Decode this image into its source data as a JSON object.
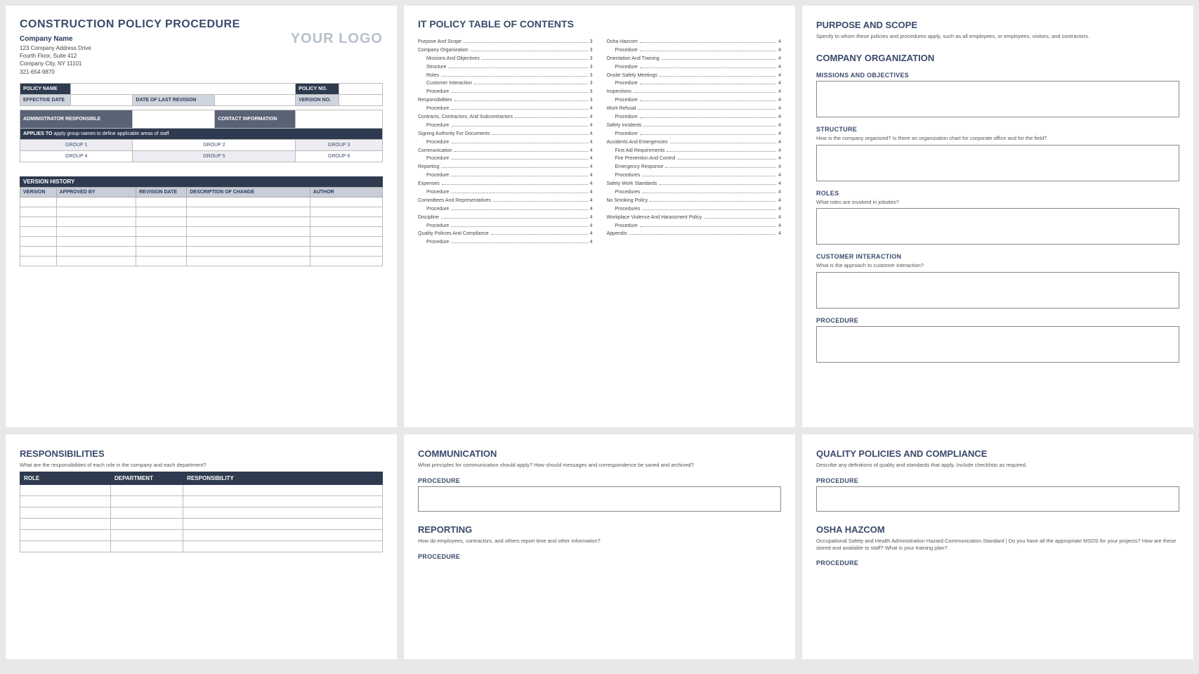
{
  "page1": {
    "title": "CONSTRUCTION POLICY PROCEDURE",
    "company": "Company Name",
    "addr1": "123 Company Address Drive",
    "addr2": "Fourth Floor, Suite 412",
    "addr3": "Company City, NY  11101",
    "phone": "321-654-9870",
    "logo": "YOUR LOGO",
    "labels": {
      "policy_name": "POLICY NAME",
      "policy_no": "POLICY NO.",
      "effective_date": "EFFECTIVE DATE",
      "last_revision": "DATE OF LAST REVISION",
      "version_no": "VERSION NO.",
      "admin": "ADMINISTRATOR RESPONSIBLE",
      "contact": "CONTACT INFORMATION",
      "applies_to_label": "APPLIES TO",
      "applies_to_text": "apply group names to define applicable areas of staff"
    },
    "groups": [
      "GROUP 1",
      "GROUP 2",
      "GROUP 3",
      "GROUP 4",
      "GROUP 5",
      "GROUP 6"
    ],
    "version_history": "VERSION HISTORY",
    "ver_headers": [
      "VERSION",
      "APPROVED BY",
      "REVISION DATE",
      "DESCRIPTION OF CHANGE",
      "AUTHOR"
    ]
  },
  "page2": {
    "title": "IT POLICY TABLE OF CONTENTS",
    "col1": [
      {
        "t": "Purpose And Scope",
        "p": "3",
        "i": 0
      },
      {
        "t": "Company Organization",
        "p": "3",
        "i": 0
      },
      {
        "t": "Missions And Objectives",
        "p": "3",
        "i": 1
      },
      {
        "t": "Structure",
        "p": "3",
        "i": 1
      },
      {
        "t": "Roles",
        "p": "3",
        "i": 1
      },
      {
        "t": "Customer Interaction",
        "p": "3",
        "i": 1
      },
      {
        "t": "Procedure",
        "p": "3",
        "i": 1
      },
      {
        "t": "Responsibilities",
        "p": "3",
        "i": 0
      },
      {
        "t": "Procedure",
        "p": "4",
        "i": 1
      },
      {
        "t": "Contracts, Contractors, And Subcontractors",
        "p": "4",
        "i": 0
      },
      {
        "t": "Procedure",
        "p": "4",
        "i": 1
      },
      {
        "t": "Signing Authority For Documents",
        "p": "4",
        "i": 0
      },
      {
        "t": "Procedure",
        "p": "4",
        "i": 1
      },
      {
        "t": "Communication",
        "p": "4",
        "i": 0
      },
      {
        "t": "Procedure",
        "p": "4",
        "i": 1
      },
      {
        "t": "Reporting",
        "p": "4",
        "i": 0
      },
      {
        "t": "Procedure",
        "p": "4",
        "i": 1
      },
      {
        "t": "Expenses",
        "p": "4",
        "i": 0
      },
      {
        "t": "Procedure",
        "p": "4",
        "i": 1
      },
      {
        "t": "Committees And Representatives",
        "p": "4",
        "i": 0
      },
      {
        "t": "Procedure",
        "p": "4",
        "i": 1
      },
      {
        "t": "Discipline",
        "p": "4",
        "i": 0
      },
      {
        "t": "Procedure",
        "p": "4",
        "i": 1
      },
      {
        "t": "Quality Policies And Compliance",
        "p": "4",
        "i": 0
      },
      {
        "t": "Procedure",
        "p": "4",
        "i": 1
      }
    ],
    "col2": [
      {
        "t": "Osha Hazcom",
        "p": "4",
        "i": 0
      },
      {
        "t": "Procedure",
        "p": "4",
        "i": 1
      },
      {
        "t": "Orientation And Training",
        "p": "4",
        "i": 0
      },
      {
        "t": "Procedure",
        "p": "4",
        "i": 1
      },
      {
        "t": "Onsite Safety Meetings",
        "p": "4",
        "i": 0
      },
      {
        "t": "Procedure",
        "p": "4",
        "i": 1
      },
      {
        "t": "Inspections",
        "p": "4",
        "i": 0
      },
      {
        "t": "Procedure",
        "p": "4",
        "i": 1
      },
      {
        "t": "Work Refusal",
        "p": "4",
        "i": 0
      },
      {
        "t": "Procedure",
        "p": "4",
        "i": 1
      },
      {
        "t": "Safety Incidents",
        "p": "4",
        "i": 0
      },
      {
        "t": "Procedure",
        "p": "4",
        "i": 1
      },
      {
        "t": "Accidents And Emergencies",
        "p": "4",
        "i": 0
      },
      {
        "t": "First Aid Requirements",
        "p": "4",
        "i": 1
      },
      {
        "t": "Fire Prevention And Control",
        "p": "4",
        "i": 1
      },
      {
        "t": "Emergency Response",
        "p": "4",
        "i": 1
      },
      {
        "t": "Procedures",
        "p": "4",
        "i": 1
      },
      {
        "t": "Safety Work Standards",
        "p": "4",
        "i": 0
      },
      {
        "t": "Procedures",
        "p": "4",
        "i": 1
      },
      {
        "t": "No Smoking Policy",
        "p": "4",
        "i": 0
      },
      {
        "t": "Procedures",
        "p": "4",
        "i": 1
      },
      {
        "t": "Workplace Violence And Harassment Policy",
        "p": "4",
        "i": 0
      },
      {
        "t": "Procedure",
        "p": "4",
        "i": 1
      },
      {
        "t": "Appendix",
        "p": "4",
        "i": 0
      }
    ]
  },
  "page3": {
    "purpose_h": "PURPOSE AND SCOPE",
    "purpose_d": "Specify to whom these policies and procedures apply, such as all employees, or employees, visitors, and contractors.",
    "org_h": "COMPANY ORGANIZATION",
    "missions_h": "MISSIONS AND OBJECTIVES",
    "structure_h": "STRUCTURE",
    "structure_d": "How is the company organized? Is there an organization chart for corporate office and for the field?",
    "roles_h": "ROLES",
    "roles_d": "What roles are involved in jobsites?",
    "customer_h": "CUSTOMER INTERACTION",
    "customer_d": "What is the approach to customer interaction?",
    "procedure_h": "PROCEDURE"
  },
  "page4": {
    "resp_h": "RESPONSIBILITIES",
    "resp_d": "What are the responsibilities of each role in the company and each department?",
    "headers": [
      "ROLE",
      "DEPARTMENT",
      "RESPONSIBILITY"
    ]
  },
  "page5": {
    "comm_h": "COMMUNICATION",
    "comm_d": "What principles for communication should apply?  How should messages and correspondence be saved and archived?",
    "procedure_h": "PROCEDURE",
    "report_h": "REPORTING",
    "report_d": "How do employees, contractors, and others report time and other information?"
  },
  "page6": {
    "qp_h": "QUALITY POLICIES AND COMPLIANCE",
    "qp_d": "Describe any definitions of quality and standards that apply.  Include checklists as required.",
    "procedure_h": "PROCEDURE",
    "osha_h": "OSHA HAZCOM",
    "osha_d": "Occupational Safety and Health Administration Hazard Communication Standard |  Do you have all the appropriate MSDS for your projects?  How are these stored and available to staff?  What is your training plan?"
  }
}
